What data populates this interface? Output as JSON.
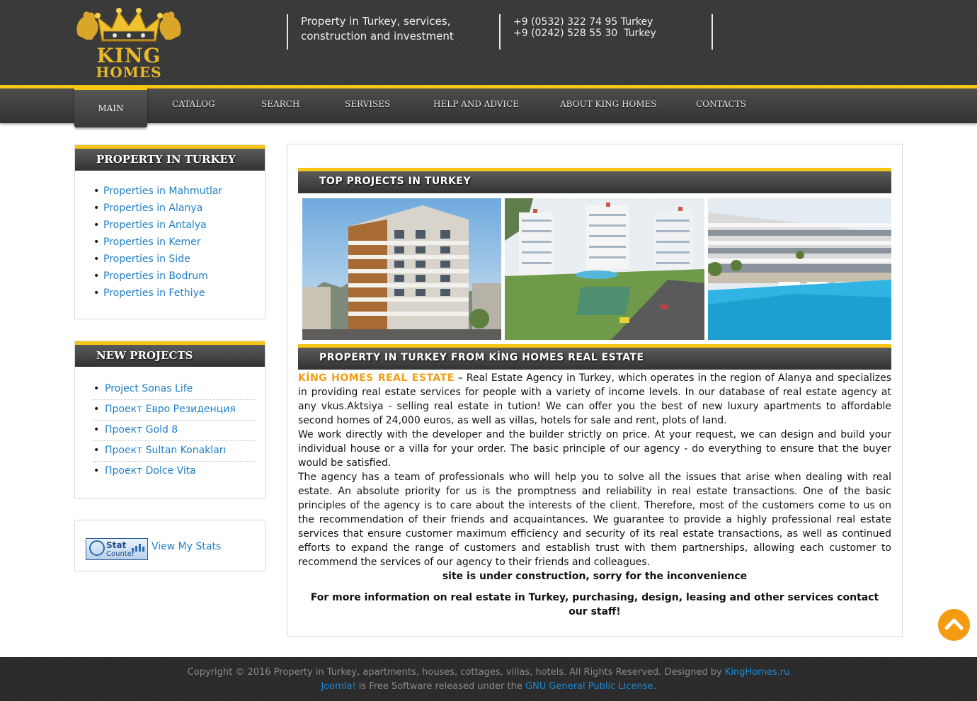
{
  "header": {
    "logo_line1": "KING",
    "logo_line2": "HOMES",
    "tagline": "Property in Turkey, services, construction and investment",
    "phones": "+9 (0532) 322 74 95 Turkey\n+9 (0242) 528 55 30  Turkey"
  },
  "nav": {
    "items": [
      {
        "label": "MAIN",
        "active": true
      },
      {
        "label": "CATALOG"
      },
      {
        "label": "SEARCH"
      },
      {
        "label": "SERVISES"
      },
      {
        "label": "HELP AND ADVICE"
      },
      {
        "label": "ABOUT KING HOMES"
      },
      {
        "label": "CONTACTS"
      }
    ]
  },
  "sidebar": {
    "property_title": "PROPERTY IN TURKEY",
    "property_links": [
      "Properties in Mahmutlar",
      "Properties in Alanya",
      "Properties in Antalya",
      "Properties in Kemer",
      "Properties in Side",
      "Properties in Bodrum",
      "Properties in Fethiye"
    ],
    "projects_title": "NEW PROJECTS",
    "projects": [
      "Project Sonas Life",
      "Проект Евро Резиденция",
      "Проект Gold 8",
      "Проект Sultan Konakları",
      "Проект Dolce Vita"
    ],
    "stat_badge_line1": "Stat",
    "stat_badge_line2": "Counter",
    "stat_link": "View My Stats"
  },
  "main": {
    "top_title": "TOP PROJECTS IN TURKEY",
    "about_title": "PROPERTY IN TURKEY FROM KİNG HOMES REAL ESTATE",
    "brand": "KİNG HOMES REAL ESTATE",
    "para1_rest": " – Real Estate Agency in Turkey, which operates in the region of Alanya and specializes in providing real estate services for people with a variety of income levels. In our database of real estate agency at any vkus.Aktsiya - selling real estate in tution! We can offer you the best of new luxury apartments to affordable second homes of 24,000 euros, as well as villas, hotels for sale and rent, plots of land.",
    "para2": "We work directly with the developer and the builder strictly on price. At your request, we can design and build your individual house or a villa for your order. The basic principle of our agency - do everything to ensure that the buyer would be satisfied.",
    "para3": "The agency has a team of professionals who will help you to solve all the issues that arise when dealing with real estate. An absolute priority for us is the promptness and reliability in real estate transactions. One of the basic principles of the agency is to care about the interests of the client. Therefore, most of the customers come to us on the recommendation of their friends and acquaintances. We guarantee to provide a highly professional real estate services that ensure customer maximum efficiency and security of its real estate transactions, as well as continued efforts to expand the range of customers and establish trust with them partnerships, allowing each customer to recommend the services of our agency to their friends and colleagues.",
    "construction": "site is under construction, sorry for the inconvenience",
    "contact": "For more information on real estate in Turkey, purchasing, design, leasing and other services contact our staff!"
  },
  "footer": {
    "copyright": "Copyright © 2016 Property in Turkey, apartments, houses, cottages, villas, hotels. All Rights Reserved. Designed by ",
    "designer": "KingHomes.ru",
    "joomla": "Joomla!",
    "free_text": " is Free Software released under the ",
    "license": "GNU General Public License."
  },
  "colors": {
    "accent_yellow": "#f5c518",
    "brand_orange": "#f39c12",
    "link_blue": "#1e7fc8",
    "header_bg": "#383838"
  },
  "icons": {
    "scroll_top": "chevron-up-icon",
    "logo": "crown-logo-icon"
  }
}
